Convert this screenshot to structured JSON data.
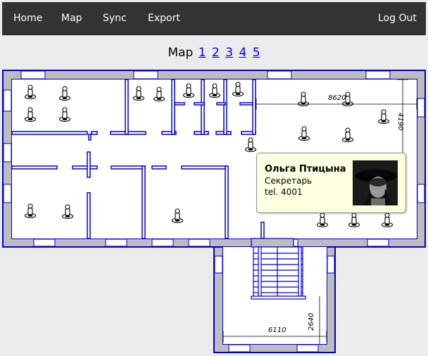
{
  "nav": {
    "home": "Home",
    "map": "Map",
    "sync": "Sync",
    "export": "Export",
    "logout": "Log Out"
  },
  "map": {
    "heading": "Map",
    "pages": [
      "1",
      "2",
      "3",
      "4",
      "5"
    ]
  },
  "plan": {
    "dimensions": {
      "width_main": "8620",
      "height_main": "4190",
      "width_wing": "6110",
      "height_wing": "2640"
    }
  },
  "popup": {
    "name": "Ольга Птицына",
    "role": "Секретарь",
    "phone": "tel. 4001"
  },
  "colors": {
    "wall": "#0000cc",
    "wall_fill": "#bdbdbd",
    "navbar": "#333333",
    "popup_bg": "#ffffe1"
  }
}
